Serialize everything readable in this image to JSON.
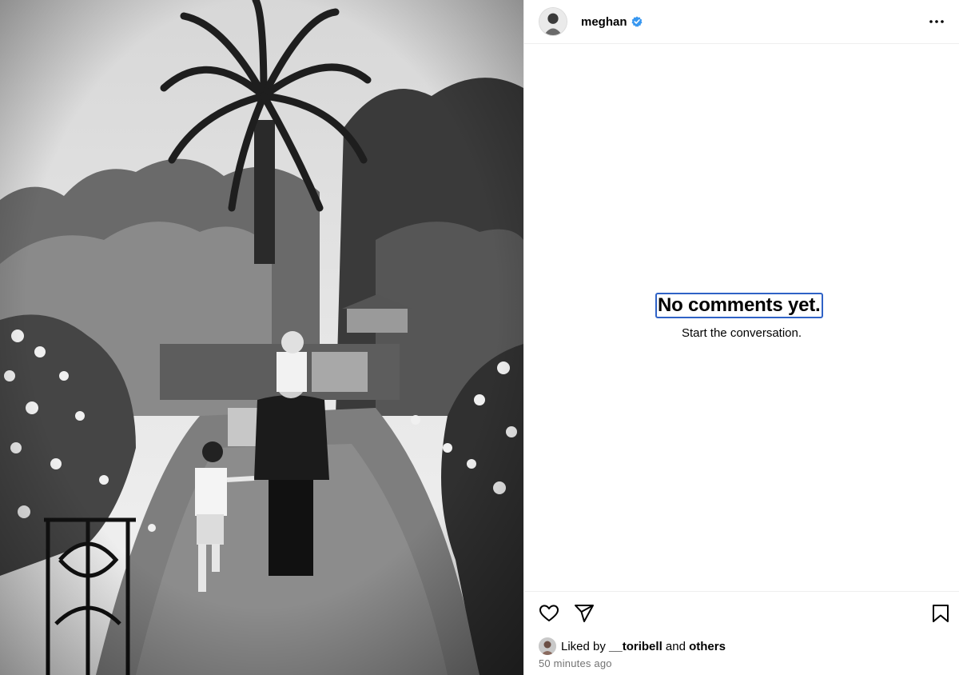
{
  "post": {
    "username": "meghan",
    "verified": true,
    "more_icon": "more-horizontal-icon"
  },
  "comments": {
    "empty_title": "No comments yet.",
    "empty_subtitle": "Start the conversation."
  },
  "actions": {
    "like_icon": "heart-icon",
    "share_icon": "paper-plane-icon",
    "save_icon": "bookmark-icon"
  },
  "likes": {
    "prefix": "Liked by",
    "user": "__toribell",
    "conjunction": "and",
    "others": "others"
  },
  "timestamp": "50 minutes ago",
  "colors": {
    "verified_badge": "#3897f0",
    "focus_outline": "#2f62c6",
    "timestamp": "#737373"
  }
}
